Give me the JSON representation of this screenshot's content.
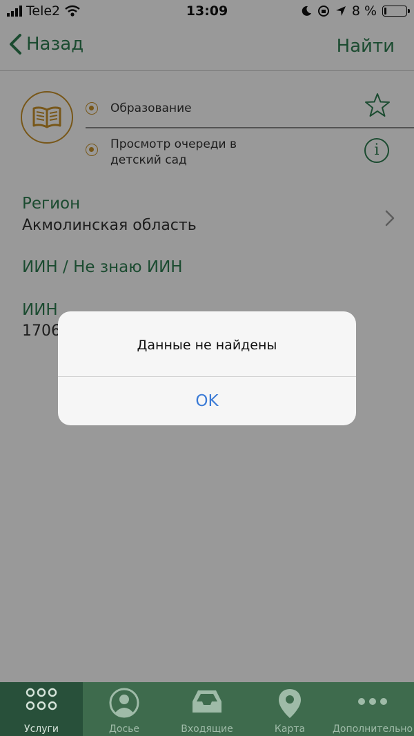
{
  "status_bar": {
    "carrier": "Tele2",
    "time": "13:09",
    "battery": "8 %"
  },
  "nav": {
    "back_label": "Назад",
    "find_label": "Найти"
  },
  "service": {
    "icon": "book-icon",
    "category": "Образование",
    "title_line1": "Просмотр очереди в",
    "title_line2": "детский сад"
  },
  "fields": {
    "region_label": "Регион",
    "region_value": "Акмолинская область",
    "iin_toggle": "ИИН / Не знаю ИИН",
    "iin_label": "ИИН",
    "iin_value": "1706"
  },
  "alert": {
    "message": "Данные не найдены",
    "ok_label": "OK"
  },
  "tabs": [
    {
      "label": "Услуги",
      "icon": "grid-dots-icon",
      "active": true
    },
    {
      "label": "Досье",
      "icon": "person-icon",
      "active": false
    },
    {
      "label": "Входящие",
      "icon": "inbox-icon",
      "active": false
    },
    {
      "label": "Карта",
      "icon": "map-pin-icon",
      "active": false
    },
    {
      "label": "Дополнительно",
      "icon": "more-dots-icon",
      "active": false
    }
  ],
  "colors": {
    "accent_green": "#2e7d51",
    "accent_gold": "#c8922a",
    "tab_bar": "#3e6b4d",
    "alert_button": "#3b7bd6"
  }
}
